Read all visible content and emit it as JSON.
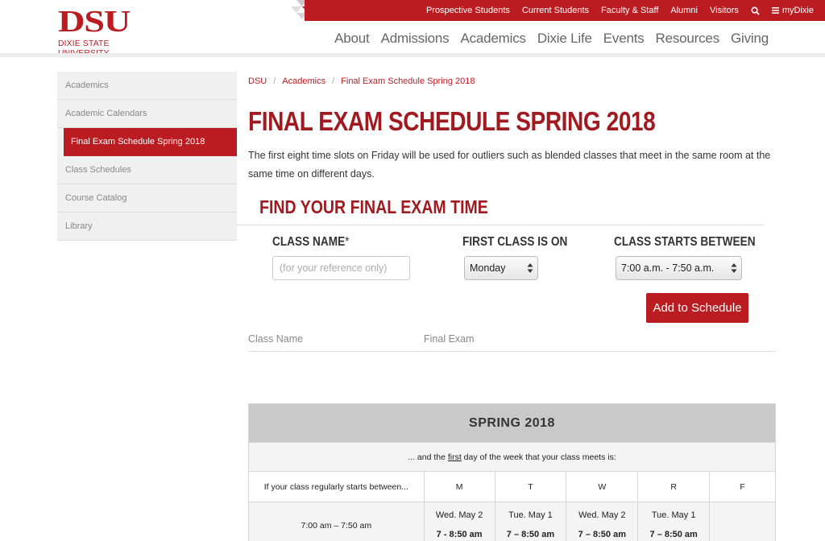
{
  "brand": {
    "logo_text": "DSU",
    "university_name": "DIXIE STATE UNIVERSITY",
    "accent_color": "#ba1c21"
  },
  "top_nav": {
    "items": [
      "Prospective Students",
      "Current Students",
      "Faculty & Staff",
      "Alumni",
      "Visitors"
    ],
    "search_icon": "search-icon",
    "menu_icon": "menu-icon",
    "menu_label": "myDixie"
  },
  "main_nav": [
    "About",
    "Admissions",
    "Academics",
    "Dixie Life",
    "Events",
    "Resources",
    "Giving"
  ],
  "sidebar": {
    "items": [
      {
        "label": "Academics"
      },
      {
        "label": "Academic Calendars"
      },
      {
        "label": "Final Exam Schedule Spring 2018",
        "active": true
      },
      {
        "label": "Class Schedules"
      },
      {
        "label": "Course Catalog"
      },
      {
        "label": "Library"
      }
    ]
  },
  "breadcrumb": {
    "items": [
      "DSU",
      "Academics",
      "Final Exam Schedule Spring 2018"
    ],
    "separator": "/"
  },
  "page": {
    "title": "FINAL EXAM SCHEDULE SPRING 2018",
    "intro": "The first eight time slots on Friday will be used for outliers such as blended classes that meet in the same room at the same time on different days."
  },
  "finder": {
    "title": "FIND YOUR FINAL EXAM TIME",
    "class_name_label": "CLASS NAME",
    "required_mark": "*",
    "class_name_placeholder": "(for your reference only)",
    "first_class_label": "FIRST CLASS IS ON",
    "first_class_value": "Monday",
    "starts_between_label": "CLASS STARTS BETWEEN",
    "starts_between_value": "7:00 a.m. - 7:50 a.m.",
    "add_button": "Add to Schedule",
    "result_headers": [
      "Class Name",
      "Final Exam"
    ]
  },
  "schedule": {
    "heading": "SPRING 2018",
    "sub_before": "... and the ",
    "sub_underline": "first",
    "sub_after": " day of the week that your class meets is:",
    "row_header": "If your class regularly starts between...",
    "days": [
      "M",
      "T",
      "W",
      "R",
      "F"
    ],
    "rows": [
      {
        "time": "7:00 am – 7:50 am",
        "cells": [
          {
            "date": "Wed. May 2",
            "time": "7 - 8:50 am"
          },
          {
            "date": "Tue. May 1",
            "time": "7 – 8:50 am"
          },
          {
            "date": "Wed. May 2",
            "time": "7 – 8:50 am"
          },
          {
            "date": "Tue. May 1",
            "time": "7 – 8:50 am"
          },
          {
            "date": "",
            "time": ""
          }
        ]
      }
    ]
  }
}
